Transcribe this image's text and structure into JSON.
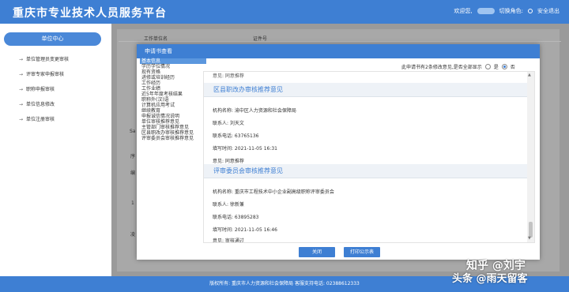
{
  "header": {
    "title": "重庆市专业技术人员服务平台",
    "welcome": "欢迎您,",
    "switch_role": "切换角色:",
    "logout": "安全退出"
  },
  "sidebar": {
    "head": "单位中心",
    "items": [
      {
        "label": "单位管理员变更审核"
      },
      {
        "label": "评审专家申报审核"
      },
      {
        "label": "职称申报审核"
      },
      {
        "label": "单位信息修改"
      },
      {
        "label": "单位注册审核"
      }
    ]
  },
  "background": {
    "col1": "工作单位名",
    "col2": "证件号",
    "side_labels": [
      "Sa",
      "序",
      "编",
      "1",
      "凌"
    ]
  },
  "modal": {
    "title": "申请书查看",
    "nav": [
      "基本信息",
      "学历学位情况",
      "现有资格",
      "进修或培训经历",
      "工作经历",
      "工作业绩",
      "近5年年度考核结果",
      "职称外(汉)语",
      "计算机应用考试",
      "继续教育",
      "申报诚信情况说明",
      "单位审核推荐意见",
      "主管部门审核推荐意见",
      "区县职改办审核推荐意见",
      "评审委员会审核推荐意见"
    ],
    "mode_text": "此申请书有2条修改意见,是否全部显示",
    "mode_yes": "是",
    "mode_no": "否",
    "content_top": "意见: 同意推荐",
    "sec1": {
      "title": "区县职改办审核推荐意见",
      "org": "机构名称:  渝中区人力资源和社会保障局",
      "contact": "联系人:  刘天文",
      "phone": "联系电话:  63765136",
      "time": "填写时间:  2021-11-05 16:31",
      "opinion": "意见:  同意推荐"
    },
    "sec2": {
      "title": "评审委员会审核推荐意见",
      "org": "机构名称:  重庆市工程技术中小企业副高级职称评审委员会",
      "contact": "联系人:  徐新兼",
      "phone": "联系电话:  63895283",
      "time": "填写时间:  2021-11-05 16:46",
      "opinion": "意见:  审核通过"
    },
    "close": "关闭",
    "print": "打印公示表"
  },
  "footer": "版权所有: 重庆市人力资源和社会保障局 客服支持电话: 02388612333",
  "watermark": {
    "zhihu": "知乎 @刘宇",
    "toutiao": "头条 @雨天留客"
  }
}
